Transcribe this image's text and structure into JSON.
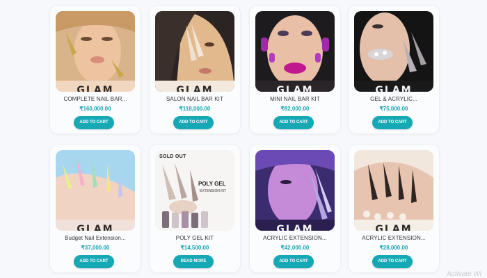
{
  "products": [
    {
      "name": "COMPLETE NAIL BAR...",
      "price": "₹160,000.00",
      "button": "ADD TO CART",
      "brand": "GLAM",
      "badge": ""
    },
    {
      "name": "SALON NAIL BAR KIT",
      "price": "₹118,000.00",
      "button": "ADD TO CART",
      "brand": "GLAM",
      "badge": ""
    },
    {
      "name": "MINI NAIL BAR KIT",
      "price": "₹82,000.00",
      "button": "ADD TO CART",
      "brand": "GLAM",
      "badge": ""
    },
    {
      "name": "GEL & ACRYLIC...",
      "price": "₹75,000.00",
      "button": "ADD TO CART",
      "brand": "GLAM",
      "badge": ""
    },
    {
      "name": "Budget Nail Extension...",
      "price": "₹37,000.00",
      "button": "ADD TO CART",
      "brand": "GLAM",
      "badge": ""
    },
    {
      "name": "POLY GEL KIT",
      "price": "₹14,500.00",
      "button": "READ MORE",
      "brand": "",
      "badge": "SOLD OUT",
      "overlay_line1": "POLY GEL",
      "overlay_line2": "EXTENSION KIT"
    },
    {
      "name": "ACRYLIC EXTENSION...",
      "price": "₹42,000.00",
      "button": "ADD TO CART",
      "brand": "GLAM",
      "badge": ""
    },
    {
      "name": "ACRYLIC EXTENSION...",
      "price": "₹28,000.00",
      "button": "ADD TO CART",
      "brand": "GLAM",
      "badge": ""
    }
  ],
  "watermark": "Activate Wi",
  "colors": {
    "accent": "#16a9b5",
    "price": "#1aa3b3"
  }
}
